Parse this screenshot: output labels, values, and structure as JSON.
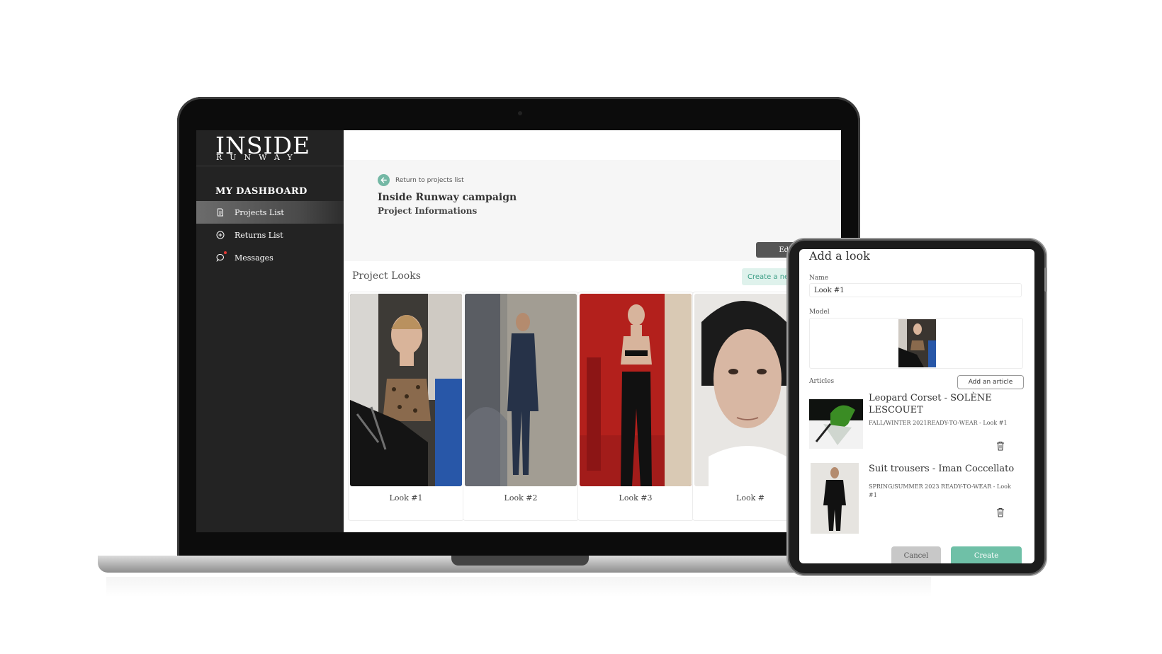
{
  "brand": {
    "logo_main": "INSIDE",
    "logo_sub": "RUNWAY"
  },
  "sidebar": {
    "title": "MY DASHBOARD",
    "items": [
      {
        "label": "Projects List",
        "icon": "document-icon",
        "active": true
      },
      {
        "label": "Returns List",
        "icon": "plus-circle-icon",
        "active": false
      },
      {
        "label": "Messages",
        "icon": "chat-bubble-icon",
        "active": false
      }
    ]
  },
  "project": {
    "back_link": "Return to projects list",
    "title": "Inside Runway campaign",
    "subtitle": "Project Informations",
    "edit_button": "Edit Project"
  },
  "looks": {
    "section_title": "Project Looks",
    "create_button": "Create a new lo",
    "items": [
      {
        "label": "Look #1"
      },
      {
        "label": "Look #2"
      },
      {
        "label": "Look #3"
      },
      {
        "label": "Look #"
      }
    ]
  },
  "modal": {
    "title": "Add a look",
    "name_label": "Name",
    "name_value": "Look #1",
    "model_label": "Model",
    "articles_label": "Articles",
    "add_article_button": "Add an article",
    "articles": [
      {
        "name": "Leopard Corset - SOLÈNE LESCOUET",
        "meta": "FALL/WINTER 2021READY-TO-WEAR - Look #1"
      },
      {
        "name": "Suit trousers - Iman Coccellato",
        "meta": "SPRING/SUMMER 2023 READY-TO-WEAR  - Look #1"
      }
    ],
    "cancel_button": "Cancel",
    "create_button": "Create"
  },
  "colors": {
    "accent": "#74b8a5",
    "sidebar_bg": "#232323",
    "create_button": "#6fc0a7"
  }
}
